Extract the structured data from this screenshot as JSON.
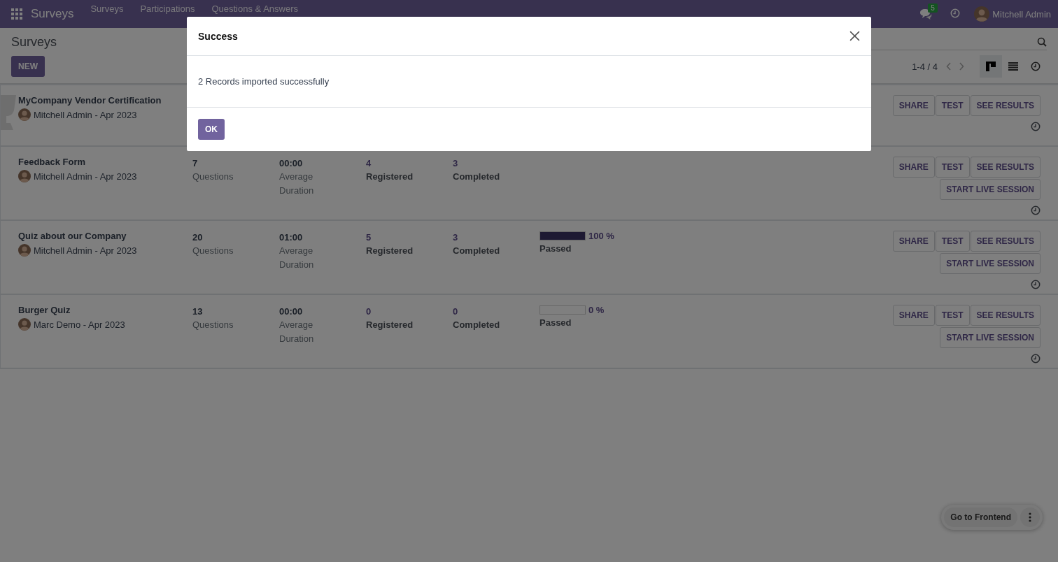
{
  "navbar": {
    "app_name": "Surveys",
    "menu": [
      "Surveys",
      "Participations",
      "Questions & Answers"
    ],
    "messages_badge": "5",
    "user": "Mitchell Admin"
  },
  "control_panel": {
    "breadcrumb": "Surveys",
    "new_button": "NEW",
    "pager": "1-4 / 4",
    "views": [
      {
        "kind": "kanban",
        "selected": true
      },
      {
        "kind": "list",
        "selected": false
      },
      {
        "kind": "activity",
        "selected": false
      }
    ]
  },
  "surveys": [
    {
      "title": "MyCompany Vendor Certification",
      "author": "Mitchell Admin - Apr 2023",
      "certification": true,
      "buttons": [
        "SHARE",
        "TEST",
        "SEE RESULTS"
      ]
    },
    {
      "title": "Feedback Form",
      "author": "Mitchell Admin - Apr 2023",
      "certification": false,
      "stats": [
        {
          "value": "7",
          "label": "Questions",
          "kind": "count"
        },
        {
          "value": "00:00",
          "label": "Average Duration",
          "kind": "count"
        },
        {
          "value": "4",
          "label": "Registered",
          "kind": "link"
        },
        {
          "value": "3",
          "label": "Completed",
          "kind": "link"
        }
      ],
      "buttons": [
        "SHARE",
        "TEST",
        "SEE RESULTS",
        "START LIVE SESSION"
      ]
    },
    {
      "title": "Quiz about our Company",
      "author": "Mitchell Admin - Apr 2023",
      "certification": false,
      "stats": [
        {
          "value": "20",
          "label": "Questions",
          "kind": "count"
        },
        {
          "value": "01:00",
          "label": "Average Duration",
          "kind": "count"
        },
        {
          "value": "5",
          "label": "Registered",
          "kind": "link"
        },
        {
          "value": "3",
          "label": "Completed",
          "kind": "link"
        }
      ],
      "success": {
        "level": 1,
        "reading": "100 %",
        "label": "Passed"
      },
      "buttons": [
        "SHARE",
        "TEST",
        "SEE RESULTS",
        "START LIVE SESSION"
      ]
    },
    {
      "title": "Burger Quiz",
      "author": "Marc Demo - Apr 2023",
      "certification": false,
      "stats": [
        {
          "value": "13",
          "label": "Questions",
          "kind": "count"
        },
        {
          "value": "00:00",
          "label": "Average Duration",
          "kind": "count"
        },
        {
          "value": "0",
          "label": "Registered",
          "kind": "link"
        },
        {
          "value": "0",
          "label": "Completed",
          "kind": "link"
        }
      ],
      "success": {
        "level": 0,
        "reading": "0 %",
        "label": "Passed"
      },
      "buttons": [
        "SHARE",
        "TEST",
        "SEE RESULTS",
        "START LIVE SESSION"
      ]
    }
  ],
  "dialog": {
    "title": "Success",
    "message": "2 Records imported successfully",
    "ok": "OK"
  },
  "frontend_button": "Go to Frontend"
}
